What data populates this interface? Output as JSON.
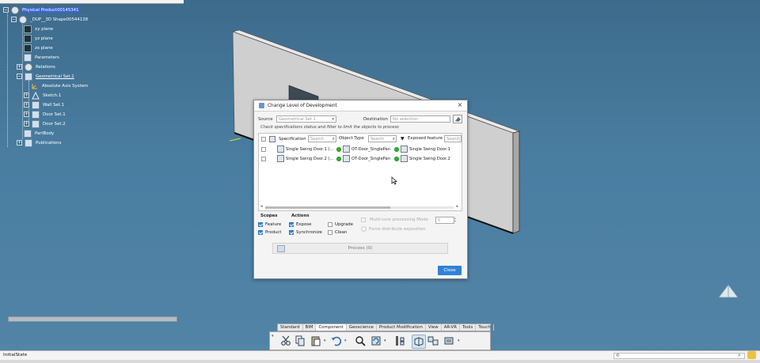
{
  "tree": {
    "root": "Physical Product00145341",
    "shape": "_DUP__3D Shape00544138",
    "items": [
      {
        "label": "xy plane"
      },
      {
        "label": "yz plane"
      },
      {
        "label": "zx plane"
      },
      {
        "label": "Parameters"
      },
      {
        "label": "Relations"
      },
      {
        "label": "Geometrical Set.1"
      },
      {
        "label": "Absolute Axis System"
      },
      {
        "label": "Sketch.1"
      },
      {
        "label": "Wall Set.1"
      },
      {
        "label": "Door Set.1"
      },
      {
        "label": "Door Set.2"
      },
      {
        "label": "PartBody"
      },
      {
        "label": "Publications"
      }
    ]
  },
  "dialog": {
    "title": "Change Level of Development",
    "close_icon": "×",
    "source_label": "Source",
    "source_value": "Geometrical Set.1",
    "destination_label": "Destination",
    "destination_placeholder": "No selection",
    "hint": "Check specifications status and filter to limit the objects to process",
    "columns": {
      "specification": "Specification",
      "object_type": "Object Type",
      "exposed_feature": "Exposed feature",
      "search_placeholder": "Search"
    },
    "rows": [
      {
        "spec": "Single Swing Door.1 (...",
        "type": "OT-Door_SinglePan",
        "exposed": "Single Swing Door.1"
      },
      {
        "spec": "Single Swing Door.2 (...",
        "type": "OT-Door_SinglePan",
        "exposed": "Single Swing Door.2"
      }
    ],
    "scopes_label": "Scopes",
    "actions_label": "Actions",
    "scopes": [
      {
        "label": "Feature",
        "checked": true
      },
      {
        "label": "Product",
        "checked": true
      }
    ],
    "actions": [
      {
        "label": "Expose",
        "checked": true
      },
      {
        "label": "Synchronize",
        "checked": true
      },
      {
        "label": "Upgrade",
        "checked": false
      },
      {
        "label": "Clean",
        "checked": false
      }
    ],
    "multicore_label": "Multi-core processing Mode",
    "multicore_value": "6",
    "force_label": "Force distribute exposition",
    "process_button": "Process (0)",
    "close_button": "Close"
  },
  "action_bar": {
    "tabs": [
      "Standard",
      "BIM",
      "Component",
      "Geoscience",
      "Product Modification",
      "View",
      "AR-VR",
      "Tools",
      "Touch"
    ],
    "active_tab": "Component"
  },
  "status_bar": {
    "text": "InitialState",
    "command_prefix": "©"
  },
  "colors": {
    "background": "#4a7ea1",
    "selection": "#3a63d6",
    "primary_button": "#2f82d8",
    "status_ok": "#28b828"
  }
}
